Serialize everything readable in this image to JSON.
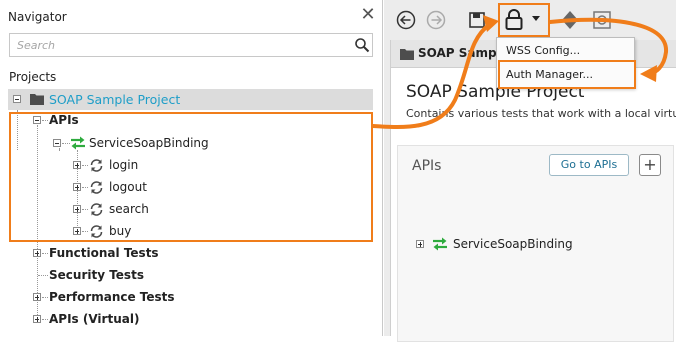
{
  "navigator": {
    "title": "Navigator",
    "close_label": "✕",
    "search_placeholder": "Search",
    "projects_label": "Projects",
    "project_name": "SOAP Sample Project",
    "apis_label": "APIs",
    "binding_label": "ServiceSoapBinding",
    "operations": [
      "login",
      "logout",
      "search",
      "buy"
    ],
    "sections": [
      "Functional Tests",
      "Security Tests",
      "Performance Tests",
      "APIs (Virtual)"
    ]
  },
  "editor": {
    "tab_label": "SOAP Sample P",
    "project_title": "SOAP Sample Project",
    "description": "Contains various tests that work with a local virtu",
    "apis_heading": "APIs",
    "goto_button": "Go to APIs",
    "add_button": "+",
    "binding_label": "ServiceSoapBinding"
  },
  "menu": {
    "items": [
      "WSS Config...",
      "Auth Manager..."
    ]
  },
  "colors": {
    "accent_orange": "#f07d1a",
    "project_blue": "#1f9ec8",
    "binding_green": "#2eab3e",
    "operation_gray": "#4a4a4a"
  },
  "icons": {
    "toolbar": [
      "back-icon",
      "forward-icon",
      "save-icon",
      "lock-icon",
      "dropdown-arrow-icon",
      "diamond-icon",
      "settings-icon"
    ],
    "tree": [
      "folder-icon",
      "binding-arrows-icon",
      "operation-cycle-icon"
    ]
  }
}
